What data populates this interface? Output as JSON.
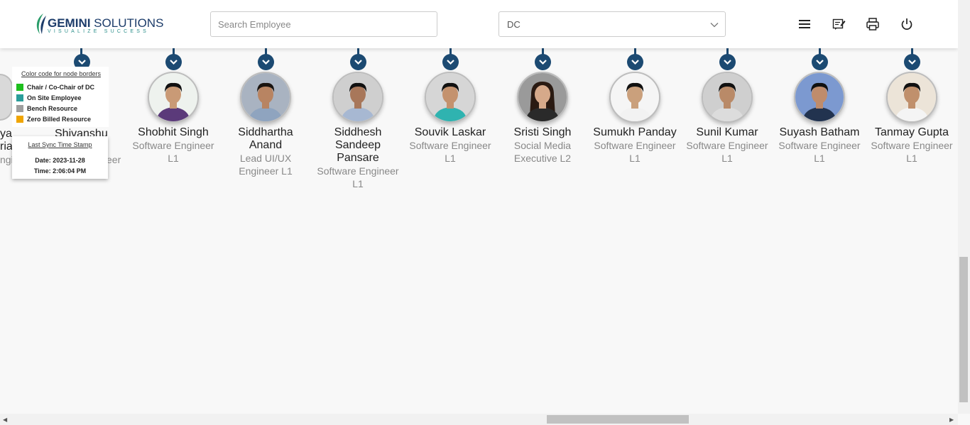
{
  "header": {
    "logo": {
      "brand_bold": "GEMINI",
      "brand_rest": " SOLUTIONS",
      "tagline": "VISUALIZE SUCCESS"
    },
    "search": {
      "placeholder": "Search Employee",
      "value": ""
    },
    "dc_select": {
      "value": "DC"
    },
    "icons": [
      "menu-icon",
      "notes-icon",
      "print-icon",
      "power-icon"
    ]
  },
  "legend": {
    "title": "Color code for node borders",
    "items": [
      {
        "label": "Chair / Co-Chair of DC",
        "color": "#1ebf1e"
      },
      {
        "label": "On Site Employee",
        "color": "#2a9d9a"
      },
      {
        "label": "Bench Resource",
        "color": "#9e9e9e"
      },
      {
        "label": "Zero Billed Resource",
        "color": "#f0a500"
      }
    ]
  },
  "sync": {
    "title": "Last Sync Time Stamp",
    "date": "Date: 2023-11-28",
    "time": "Time: 2:06:04 PM"
  },
  "partial": {
    "n1a": "ya",
    "n1b": "ria",
    "r1": "ngi",
    "n2": "Shivanshu",
    "r2": "eer"
  },
  "nodes": [
    {
      "name": "Shobhit Singh",
      "role": "Software Engineer L1"
    },
    {
      "name": "Siddhartha Anand",
      "role": "Lead UI/UX Engineer L1"
    },
    {
      "name": "Siddhesh Sandeep Pansare",
      "role": "Software Engineer L1"
    },
    {
      "name": "Souvik Laskar",
      "role": "Software Engineer L1"
    },
    {
      "name": "Sristi Singh",
      "role": "Social Media Executive L2"
    },
    {
      "name": "Sumukh Panday",
      "role": "Software Engineer L1"
    },
    {
      "name": "Sunil Kumar",
      "role": "Software Engineer L1"
    },
    {
      "name": "Suyash Batham",
      "role": "Software Engineer L1"
    },
    {
      "name": "Tanmay Gupta",
      "role": "Software Engineer L1"
    }
  ],
  "colors": {
    "accent": "#1c4a72",
    "brand": "#1c3c6a"
  }
}
